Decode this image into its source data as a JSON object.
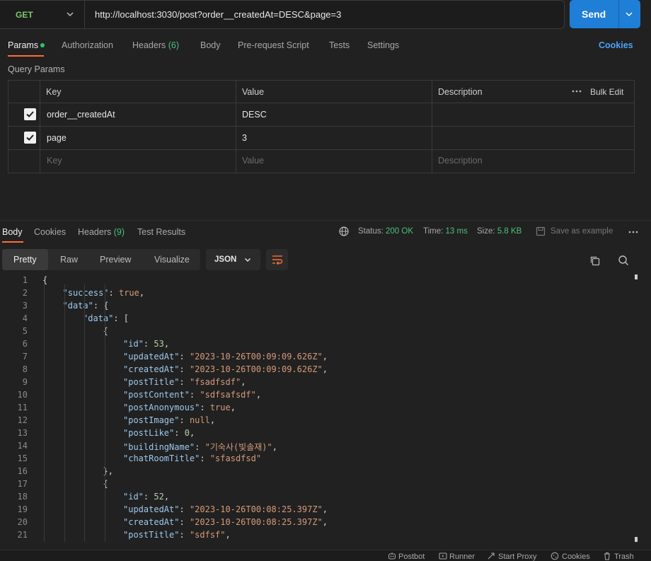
{
  "request": {
    "method": "GET",
    "url": "http://localhost:3030/post?order__createdAt=DESC&page=3",
    "send_label": "Send"
  },
  "tabs": {
    "params": "Params",
    "authorization": "Authorization",
    "headers": "Headers",
    "headers_count": "(6)",
    "body": "Body",
    "prerequest": "Pre-request Script",
    "tests": "Tests",
    "settings": "Settings",
    "cookies": "Cookies"
  },
  "query_params": {
    "title": "Query Params",
    "headers": {
      "key": "Key",
      "value": "Value",
      "description": "Description",
      "bulk_edit": "Bulk Edit"
    },
    "rows": [
      {
        "key": "order__createdAt",
        "value": "DESC",
        "checked": true
      },
      {
        "key": "page",
        "value": "3",
        "checked": true
      }
    ],
    "placeholder": {
      "key": "Key",
      "value": "Value",
      "description": "Description"
    }
  },
  "response": {
    "tabs": {
      "body": "Body",
      "cookies": "Cookies",
      "headers": "Headers",
      "headers_count": "(9)",
      "test_results": "Test Results"
    },
    "status_label": "Status:",
    "status_value": "200 OK",
    "time_label": "Time:",
    "time_value": "13 ms",
    "size_label": "Size:",
    "size_value": "5.8 KB",
    "save_example": "Save as example",
    "views": [
      "Pretty",
      "Raw",
      "Preview",
      "Visualize"
    ],
    "format": "JSON"
  },
  "code_lines": [
    "{",
    "\"success\": true,",
    "\"data\": {",
    "\"data\": [",
    "{",
    "\"id\": 53,",
    "\"updatedAt\": \"2023-10-26T00:09:09.626Z\",",
    "\"createdAt\": \"2023-10-26T00:09:09.626Z\",",
    "\"postTitle\": \"fsadfsdf\",",
    "\"postContent\": \"sdfsafsdf\",",
    "\"postAnonymous\": true,",
    "\"postImage\": null,",
    "\"postLike\": 0,",
    "\"buildingName\": \"기숙사(빛솔재)\",",
    "\"chatRoomTitle\": \"sfasdfsd\"",
    "},",
    "{",
    "\"id\": 52,",
    "\"updatedAt\": \"2023-10-26T00:08:25.397Z\",",
    "\"createdAt\": \"2023-10-26T00:08:25.397Z\",",
    "\"postTitle\": \"sdfsf\","
  ],
  "statusbar": {
    "postbot": "Postbot",
    "runner": "Runner",
    "start_proxy": "Start Proxy",
    "cookies": "Cookies",
    "trash": "Trash"
  },
  "colors": {
    "accent": "#ff6c37",
    "send": "#1f7ed6",
    "get_method": "#7cc86a",
    "status_ok": "#4cc07a",
    "link": "#4aa3ff"
  }
}
